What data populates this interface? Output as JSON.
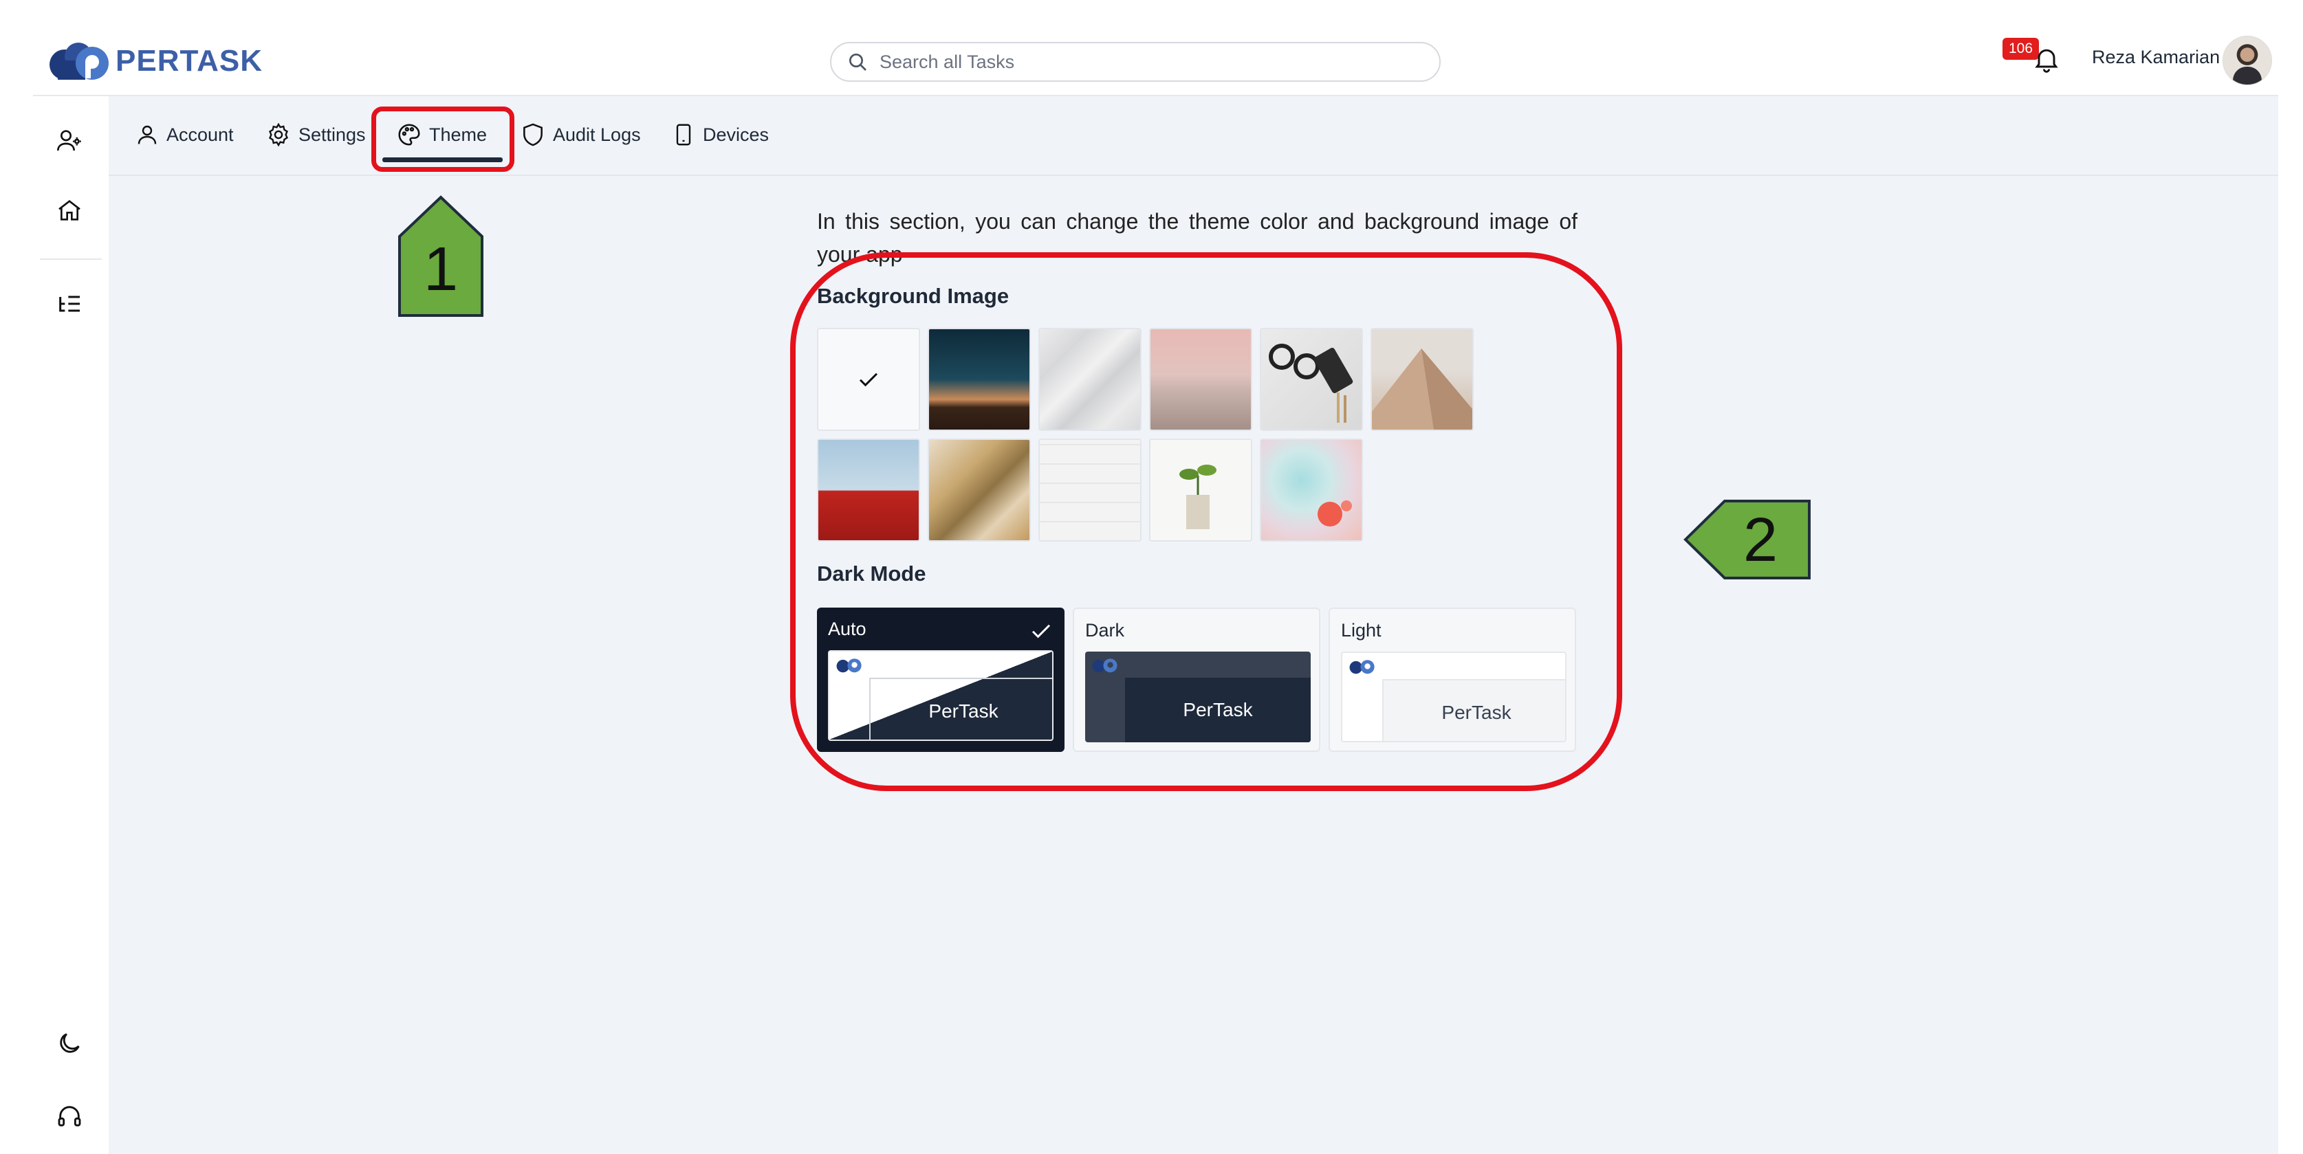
{
  "header": {
    "logo_text": "PERTASK",
    "search_placeholder": "Search all Tasks",
    "notification_count": "106",
    "user_name": "Reza Kamarian"
  },
  "sidebar": {
    "items": [
      "add-user-icon",
      "home-icon",
      "task-list-icon"
    ],
    "bottom_items": [
      "moon-icon",
      "headset-icon"
    ]
  },
  "tabs": [
    {
      "label": "Account",
      "icon": "user-icon"
    },
    {
      "label": "Settings",
      "icon": "gear-icon"
    },
    {
      "label": "Theme",
      "icon": "palette-icon",
      "active": true
    },
    {
      "label": "Audit Logs",
      "icon": "shield-icon"
    },
    {
      "label": "Devices",
      "icon": "phone-icon"
    }
  ],
  "theme": {
    "description": "In this section, you can change the theme color and background image of your app",
    "background_heading": "Background Image",
    "dark_mode_heading": "Dark Mode",
    "backgrounds_selected_index": 0,
    "modes": [
      {
        "label": "Auto",
        "preview": "PerTask",
        "selected": true
      },
      {
        "label": "Dark",
        "preview": "PerTask",
        "selected": false
      },
      {
        "label": "Light",
        "preview": "PerTask",
        "selected": false
      }
    ]
  },
  "annotations": {
    "callout_1": "1",
    "callout_2": "2",
    "highlight_color": "#e3121c",
    "callout_color": "#6aaa3e"
  },
  "colors": {
    "brand": "#3d5fa8",
    "main_bg": "#f0f3f8",
    "dark_card": "#111827",
    "badge": "#e11d1d"
  }
}
